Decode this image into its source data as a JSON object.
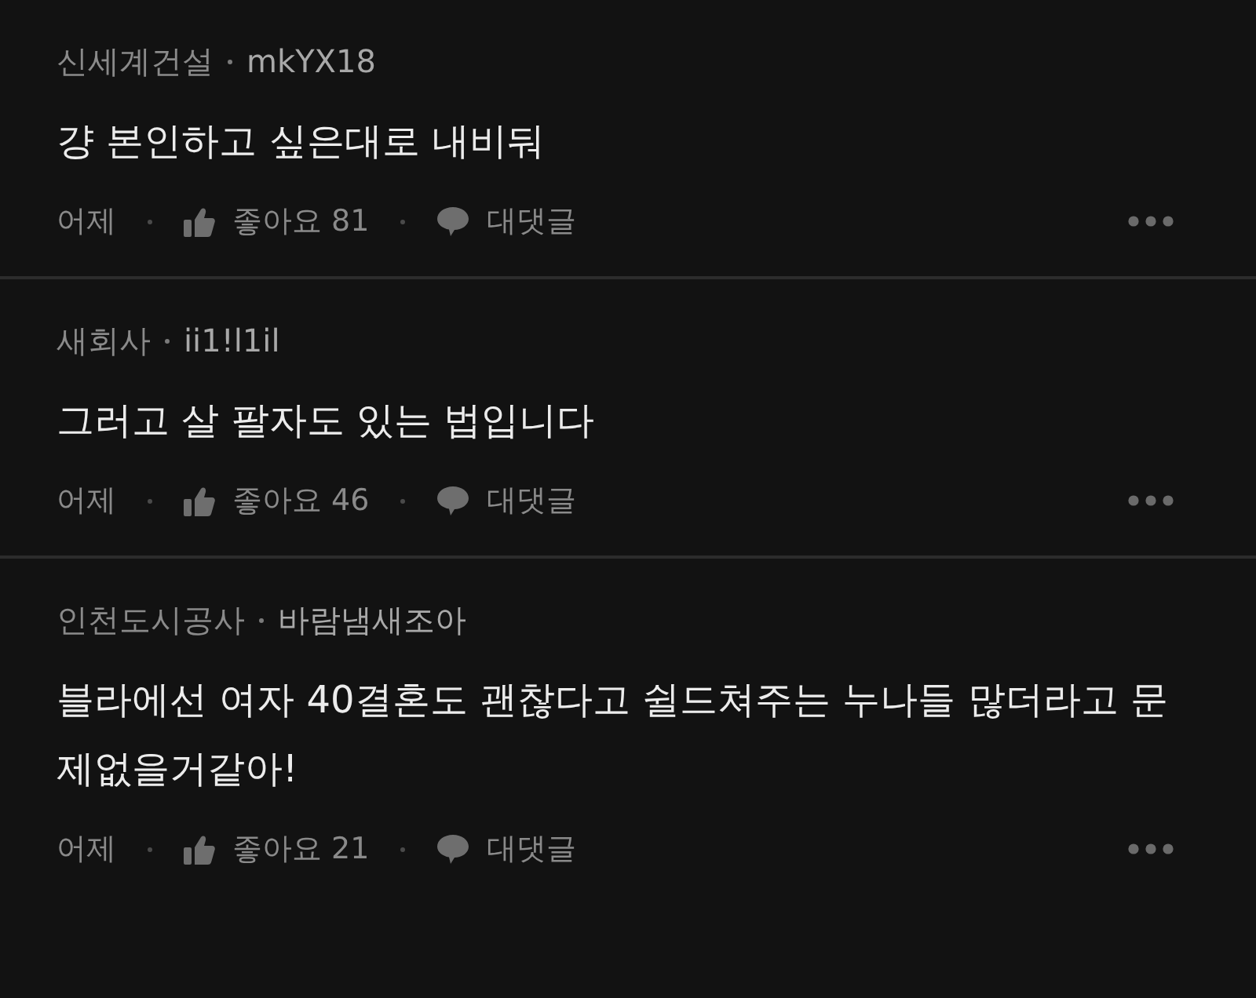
{
  "comments": [
    {
      "company": "신세계건설",
      "nickname": "mkYX18",
      "body": "걍 본인하고 싶은대로 내비둬",
      "time": "어제",
      "likes": "좋아요 81",
      "reply": "대댓글"
    },
    {
      "company": "새회사",
      "nickname": "ii1!l1il",
      "body": "그러고 살 팔자도 있는 법입니다",
      "time": "어제",
      "likes": "좋아요 46",
      "reply": "대댓글"
    },
    {
      "company": "인천도시공사",
      "nickname": "바람냄새조아",
      "body": "블라에선 여자 40결혼도 괜찮다고 쉴드쳐주는 누나들 많더라고 문제없을거같아!",
      "time": "어제",
      "likes": "좋아요 21",
      "reply": "대댓글"
    }
  ]
}
